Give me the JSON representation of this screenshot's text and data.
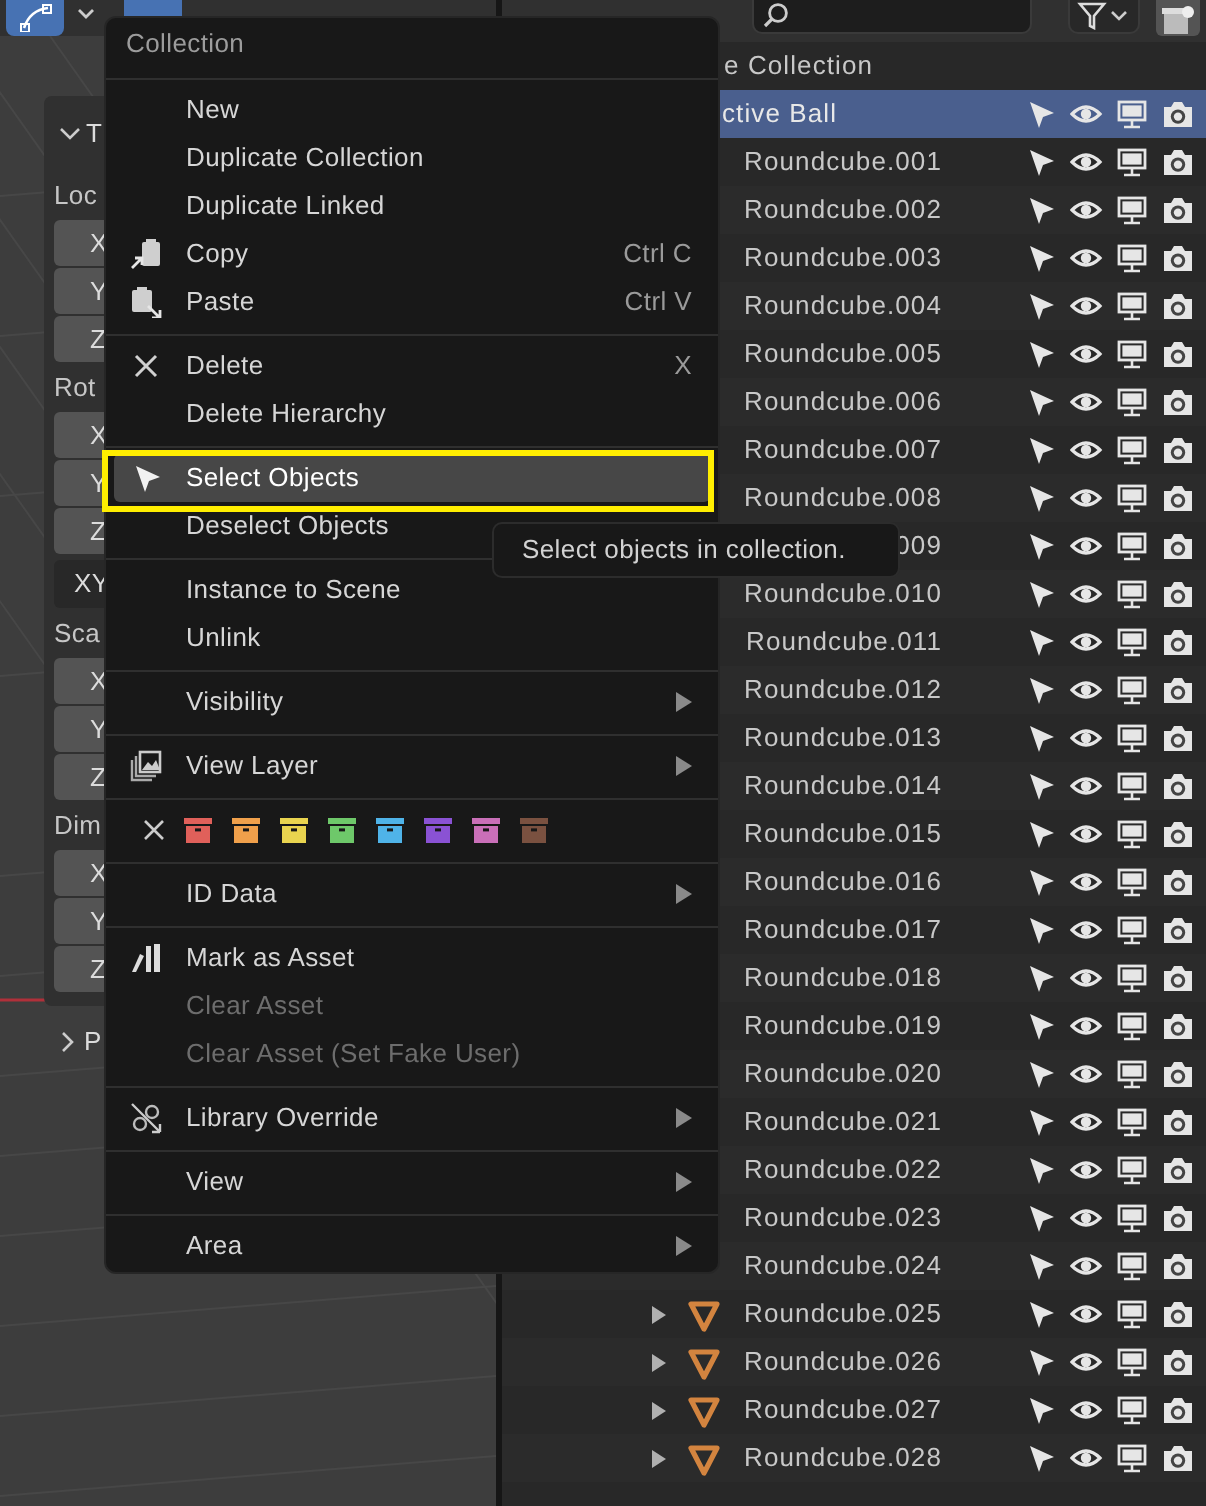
{
  "n_panel": {
    "panels": [
      {
        "title": "T",
        "expanded": true,
        "groups": [
          {
            "label": "Loc",
            "fields": [
              "X",
              "Y",
              "Z"
            ]
          },
          {
            "label": "Rot",
            "fields": [
              "X",
              "Y",
              "Z"
            ],
            "mode": "XY"
          },
          {
            "label": "Sca",
            "fields": [
              "X",
              "Y",
              "Z"
            ]
          },
          {
            "label": "Dim",
            "fields": [
              "X",
              "Y",
              "Z"
            ]
          }
        ]
      },
      {
        "title": "P",
        "expanded": false
      }
    ]
  },
  "outliner": {
    "rows": [
      {
        "kind": "scene",
        "name": "e Collection",
        "selected": false
      },
      {
        "kind": "object",
        "name": "ctive Ball",
        "selected": true
      },
      {
        "kind": "mesh",
        "name": "Roundcube.001",
        "selected": false
      },
      {
        "kind": "mesh",
        "name": "Roundcube.002",
        "selected": false
      },
      {
        "kind": "mesh",
        "name": "Roundcube.003",
        "selected": false
      },
      {
        "kind": "mesh",
        "name": "Roundcube.004",
        "selected": false
      },
      {
        "kind": "mesh",
        "name": "Roundcube.005",
        "selected": false
      },
      {
        "kind": "mesh",
        "name": "Roundcube.006",
        "selected": false
      },
      {
        "kind": "mesh",
        "name": "Roundcube.007",
        "selected": false
      },
      {
        "kind": "mesh",
        "name": "Roundcube.008",
        "selected": false
      },
      {
        "kind": "mesh",
        "name": "009",
        "selected": false
      },
      {
        "kind": "mesh",
        "name": "Roundcube.010",
        "selected": false
      },
      {
        "kind": "mesh",
        "name": "Roundcube.011",
        "selected": false
      },
      {
        "kind": "mesh",
        "name": "Roundcube.012",
        "selected": false
      },
      {
        "kind": "mesh",
        "name": "Roundcube.013",
        "selected": false
      },
      {
        "kind": "mesh",
        "name": "Roundcube.014",
        "selected": false
      },
      {
        "kind": "mesh",
        "name": "Roundcube.015",
        "selected": false
      },
      {
        "kind": "mesh",
        "name": "Roundcube.016",
        "selected": false
      },
      {
        "kind": "mesh",
        "name": "Roundcube.017",
        "selected": false
      },
      {
        "kind": "mesh",
        "name": "Roundcube.018",
        "selected": false
      },
      {
        "kind": "mesh",
        "name": "Roundcube.019",
        "selected": false
      },
      {
        "kind": "mesh",
        "name": "Roundcube.020",
        "selected": false
      },
      {
        "kind": "mesh",
        "name": "Roundcube.021",
        "selected": false
      },
      {
        "kind": "mesh",
        "name": "Roundcube.022",
        "selected": false
      },
      {
        "kind": "mesh",
        "name": "Roundcube.023",
        "selected": false
      },
      {
        "kind": "mesh",
        "name": "Roundcube.024",
        "selected": false
      },
      {
        "kind": "mesh",
        "name": "Roundcube.025",
        "selected": false,
        "expanded": false
      },
      {
        "kind": "mesh",
        "name": "Roundcube.026",
        "selected": false,
        "expanded": false
      },
      {
        "kind": "mesh",
        "name": "Roundcube.027",
        "selected": false,
        "expanded": false
      },
      {
        "kind": "mesh",
        "name": "Roundcube.028",
        "selected": false,
        "expanded": false
      }
    ]
  },
  "context_menu": {
    "title": "Collection",
    "items": [
      {
        "kind": "plain",
        "label": "New",
        "selected": false,
        "disabled": false,
        "submenu": false
      },
      {
        "kind": "plain",
        "label": "Duplicate Collection",
        "selected": false,
        "disabled": false,
        "submenu": false
      },
      {
        "kind": "plain",
        "label": "Duplicate Linked",
        "selected": false,
        "disabled": false,
        "submenu": false
      },
      {
        "kind": "copy",
        "label": "Copy",
        "shortcut": "Ctrl C",
        "selected": false,
        "disabled": false,
        "submenu": false
      },
      {
        "kind": "paste",
        "label": "Paste",
        "shortcut": "Ctrl V",
        "selected": false,
        "disabled": false,
        "submenu": false
      },
      {
        "kind": "separator"
      },
      {
        "kind": "delete",
        "label": "Delete",
        "shortcut": "X",
        "selected": false,
        "disabled": false,
        "submenu": false
      },
      {
        "kind": "plain",
        "label": "Delete Hierarchy",
        "selected": false,
        "disabled": false,
        "submenu": false
      },
      {
        "kind": "separator"
      },
      {
        "kind": "select",
        "label": "Select Objects",
        "selected": true,
        "disabled": false,
        "submenu": false
      },
      {
        "kind": "plain",
        "label": "Deselect Objects",
        "selected": false,
        "disabled": false,
        "submenu": false
      },
      {
        "kind": "separator"
      },
      {
        "kind": "plain",
        "label": "Instance to Scene",
        "selected": false,
        "disabled": false,
        "submenu": false
      },
      {
        "kind": "plain",
        "label": "Unlink",
        "selected": false,
        "disabled": false,
        "submenu": false
      },
      {
        "kind": "separator"
      },
      {
        "kind": "plain",
        "label": "Visibility",
        "selected": false,
        "disabled": false,
        "submenu": true
      },
      {
        "kind": "separator"
      },
      {
        "kind": "view-layer",
        "label": "View Layer",
        "selected": false,
        "disabled": false,
        "submenu": true
      },
      {
        "kind": "separator"
      },
      {
        "kind": "color-tags",
        "tags": [
          {
            "color": "#e0605a"
          },
          {
            "color": "#f0a04b"
          },
          {
            "color": "#e9d44f"
          },
          {
            "color": "#6ec86a"
          },
          {
            "color": "#4fb3e8"
          },
          {
            "color": "#8a52d4"
          },
          {
            "color": "#c96fb8"
          },
          {
            "color": "#7a5140"
          }
        ]
      },
      {
        "kind": "separator"
      },
      {
        "kind": "plain",
        "label": "ID Data",
        "selected": false,
        "disabled": false,
        "submenu": true
      },
      {
        "kind": "separator"
      },
      {
        "kind": "asset",
        "label": "Mark as Asset",
        "selected": false,
        "disabled": false,
        "submenu": false
      },
      {
        "kind": "plain",
        "label": "Clear Asset",
        "selected": false,
        "disabled": true,
        "submenu": false
      },
      {
        "kind": "plain",
        "label": "Clear Asset (Set Fake User)",
        "selected": false,
        "disabled": true,
        "submenu": false
      },
      {
        "kind": "separator"
      },
      {
        "kind": "override",
        "label": "Library Override",
        "selected": false,
        "disabled": false,
        "submenu": true
      },
      {
        "kind": "separator"
      },
      {
        "kind": "plain",
        "label": "View",
        "selected": false,
        "disabled": false,
        "submenu": true
      },
      {
        "kind": "separator"
      },
      {
        "kind": "plain",
        "label": "Area",
        "selected": false,
        "disabled": false,
        "submenu": true
      }
    ]
  },
  "tooltip": {
    "text": "Select objects in collection."
  }
}
